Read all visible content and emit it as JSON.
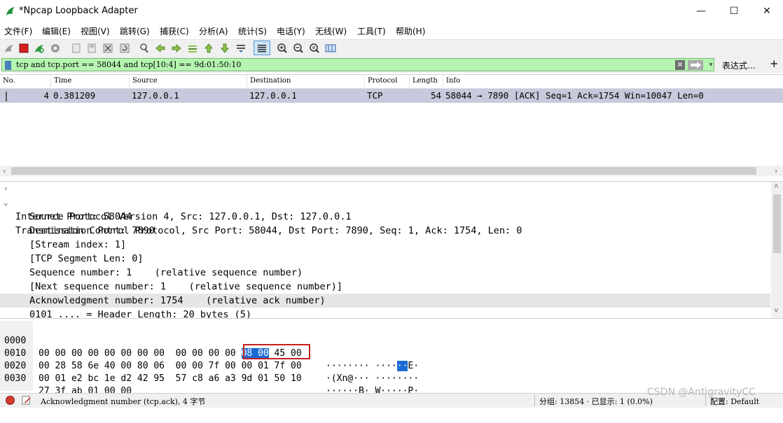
{
  "window": {
    "title": "*Npcap Loopback Adapter",
    "min_label": "—",
    "max_label": "☐",
    "close_label": "✕"
  },
  "menu": [
    "文件(F)",
    "编辑(E)",
    "视图(V)",
    "跳转(G)",
    "捕获(C)",
    "分析(A)",
    "统计(S)",
    "电话(Y)",
    "无线(W)",
    "工具(T)",
    "帮助(H)"
  ],
  "toolbar_icons": [
    "shark-fin-start-icon",
    "stop-capture-icon",
    "restart-capture-icon",
    "capture-options-icon",
    "open-file-icon",
    "save-file-icon",
    "close-file-icon",
    "reload-file-icon",
    "find-packet-icon",
    "go-back-icon",
    "go-forward-icon",
    "go-to-packet-icon",
    "go-first-icon",
    "go-last-icon",
    "auto-scroll-icon",
    "colorize-icon",
    "zoom-in-icon",
    "zoom-out-icon",
    "normal-size-icon",
    "resize-columns-icon"
  ],
  "filter": {
    "value": "tcp and tcp.port == 58044 and tcp[10:4] == 9d:01:50:10",
    "clear_label": "✕",
    "dropdown_label": "▾",
    "expression_label": "表达式…",
    "add_label": "+"
  },
  "packet_list": {
    "columns": [
      "No.",
      "Time",
      "Source",
      "Destination",
      "Protocol",
      "Length",
      "Info"
    ],
    "rows": [
      {
        "no": "4",
        "time": "0.381209",
        "source": "127.0.0.1",
        "destination": "127.0.0.1",
        "protocol": "TCP",
        "length": "54",
        "info": "58044 → 7890 [ACK] Seq=1 Ack=1754 Win=10047 Len=0"
      }
    ]
  },
  "details": [
    {
      "text": "Internet Protocol Version 4, Src: 127.0.0.1, Dst: 127.0.0.1",
      "expander": "›",
      "indent": 0
    },
    {
      "text": "Transmission Control Protocol, Src Port: 58044, Dst Port: 7890, Seq: 1, Ack: 1754, Len: 0",
      "expander": "⌄",
      "indent": 0
    },
    {
      "text": "Source Port: 58044",
      "expander": "",
      "indent": 1
    },
    {
      "text": "Destination Port: 7890",
      "expander": "",
      "indent": 1
    },
    {
      "text": "[Stream index: 1]",
      "expander": "",
      "indent": 1
    },
    {
      "text": "[TCP Segment Len: 0]",
      "expander": "",
      "indent": 1
    },
    {
      "text": "Sequence number: 1    (relative sequence number)",
      "expander": "",
      "indent": 1
    },
    {
      "text": "[Next sequence number: 1    (relative sequence number)]",
      "expander": "",
      "indent": 1
    },
    {
      "text": "Acknowledgment number: 1754    (relative ack number)",
      "expander": "",
      "indent": 1,
      "selected": true
    },
    {
      "text": "0101 .... = Header Length: 20 bytes (5)",
      "expander": "",
      "indent": 1
    }
  ],
  "bytes": [
    {
      "offset": "0000",
      "hex_a": "00 00 00 00 00 00 00 00  00 00 00 00 ",
      "hex_hl": "08 00",
      "hex_b": " 45 00",
      "ascii_a": "········ ····",
      "ascii_hl": "··",
      "ascii_b": "E·"
    },
    {
      "offset": "0010",
      "hex_a": "00 28 58 6e 40 00 80 06  00 00 7f 00 00 01 7f 00",
      "hex_hl": "",
      "hex_b": "",
      "ascii_a": "·(Xn@··· ········",
      "ascii_hl": "",
      "ascii_b": ""
    },
    {
      "offset": "0020",
      "hex_a": "00 01 e2 bc 1e d2 42 95  57 c8 a6 a3 9d 01 50 10",
      "hex_hl": "",
      "hex_b": "",
      "ascii_a": "······B· W·····P·",
      "ascii_hl": "",
      "ascii_b": ""
    },
    {
      "offset": "0030",
      "hex_a": "27 3f ab 01 00 00",
      "hex_hl": "",
      "hex_b": "",
      "ascii_a": "'?····",
      "ascii_hl": "",
      "ascii_b": ""
    }
  ],
  "status": {
    "field_text": "Acknowledgment number (tcp.ack), 4 字节",
    "packets_text": "分组: 13854 · 已显示: 1 (0.0%)",
    "profile_text": "配置: Default"
  },
  "watermark": "CSDN @AntigravityCC",
  "colors": {
    "filter_valid_bg": "#b5f5b0",
    "selected_row_bg": "#c9c9dd",
    "byte_highlight": "#1c6bd4",
    "annotation_box": "#c42020"
  }
}
